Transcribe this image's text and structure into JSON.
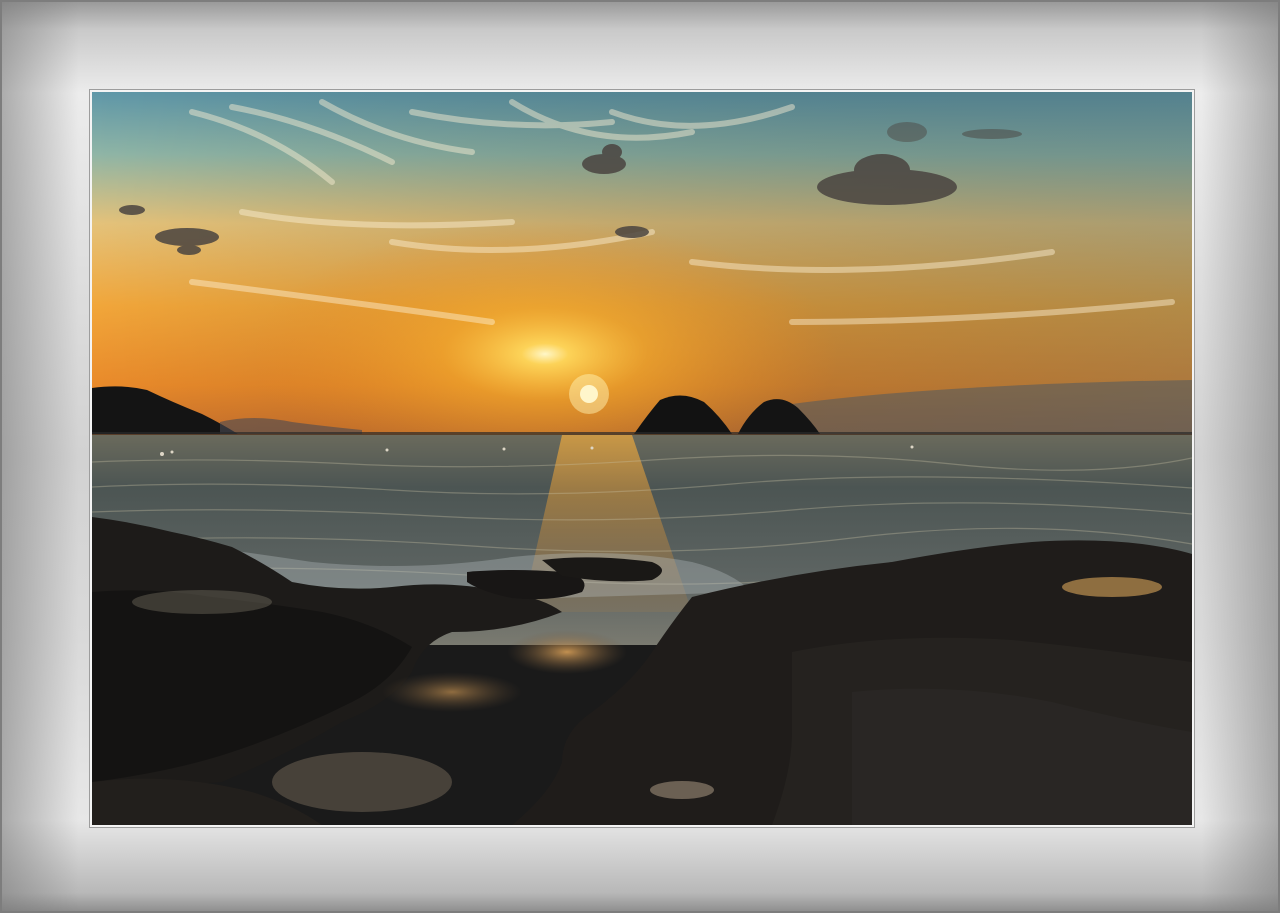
{
  "image": {
    "subject": "sunset-over-sea",
    "colors": {
      "sky_top": "#5f97a8",
      "sky_mid": "#e9b255",
      "sky_horizon": "#f29a2a",
      "sun": "#fff6c8",
      "sea": "#3c4a4c",
      "rock": "#1c1a18",
      "frame": "#dcdcdc",
      "matte_border": "#f4f4f4"
    }
  }
}
